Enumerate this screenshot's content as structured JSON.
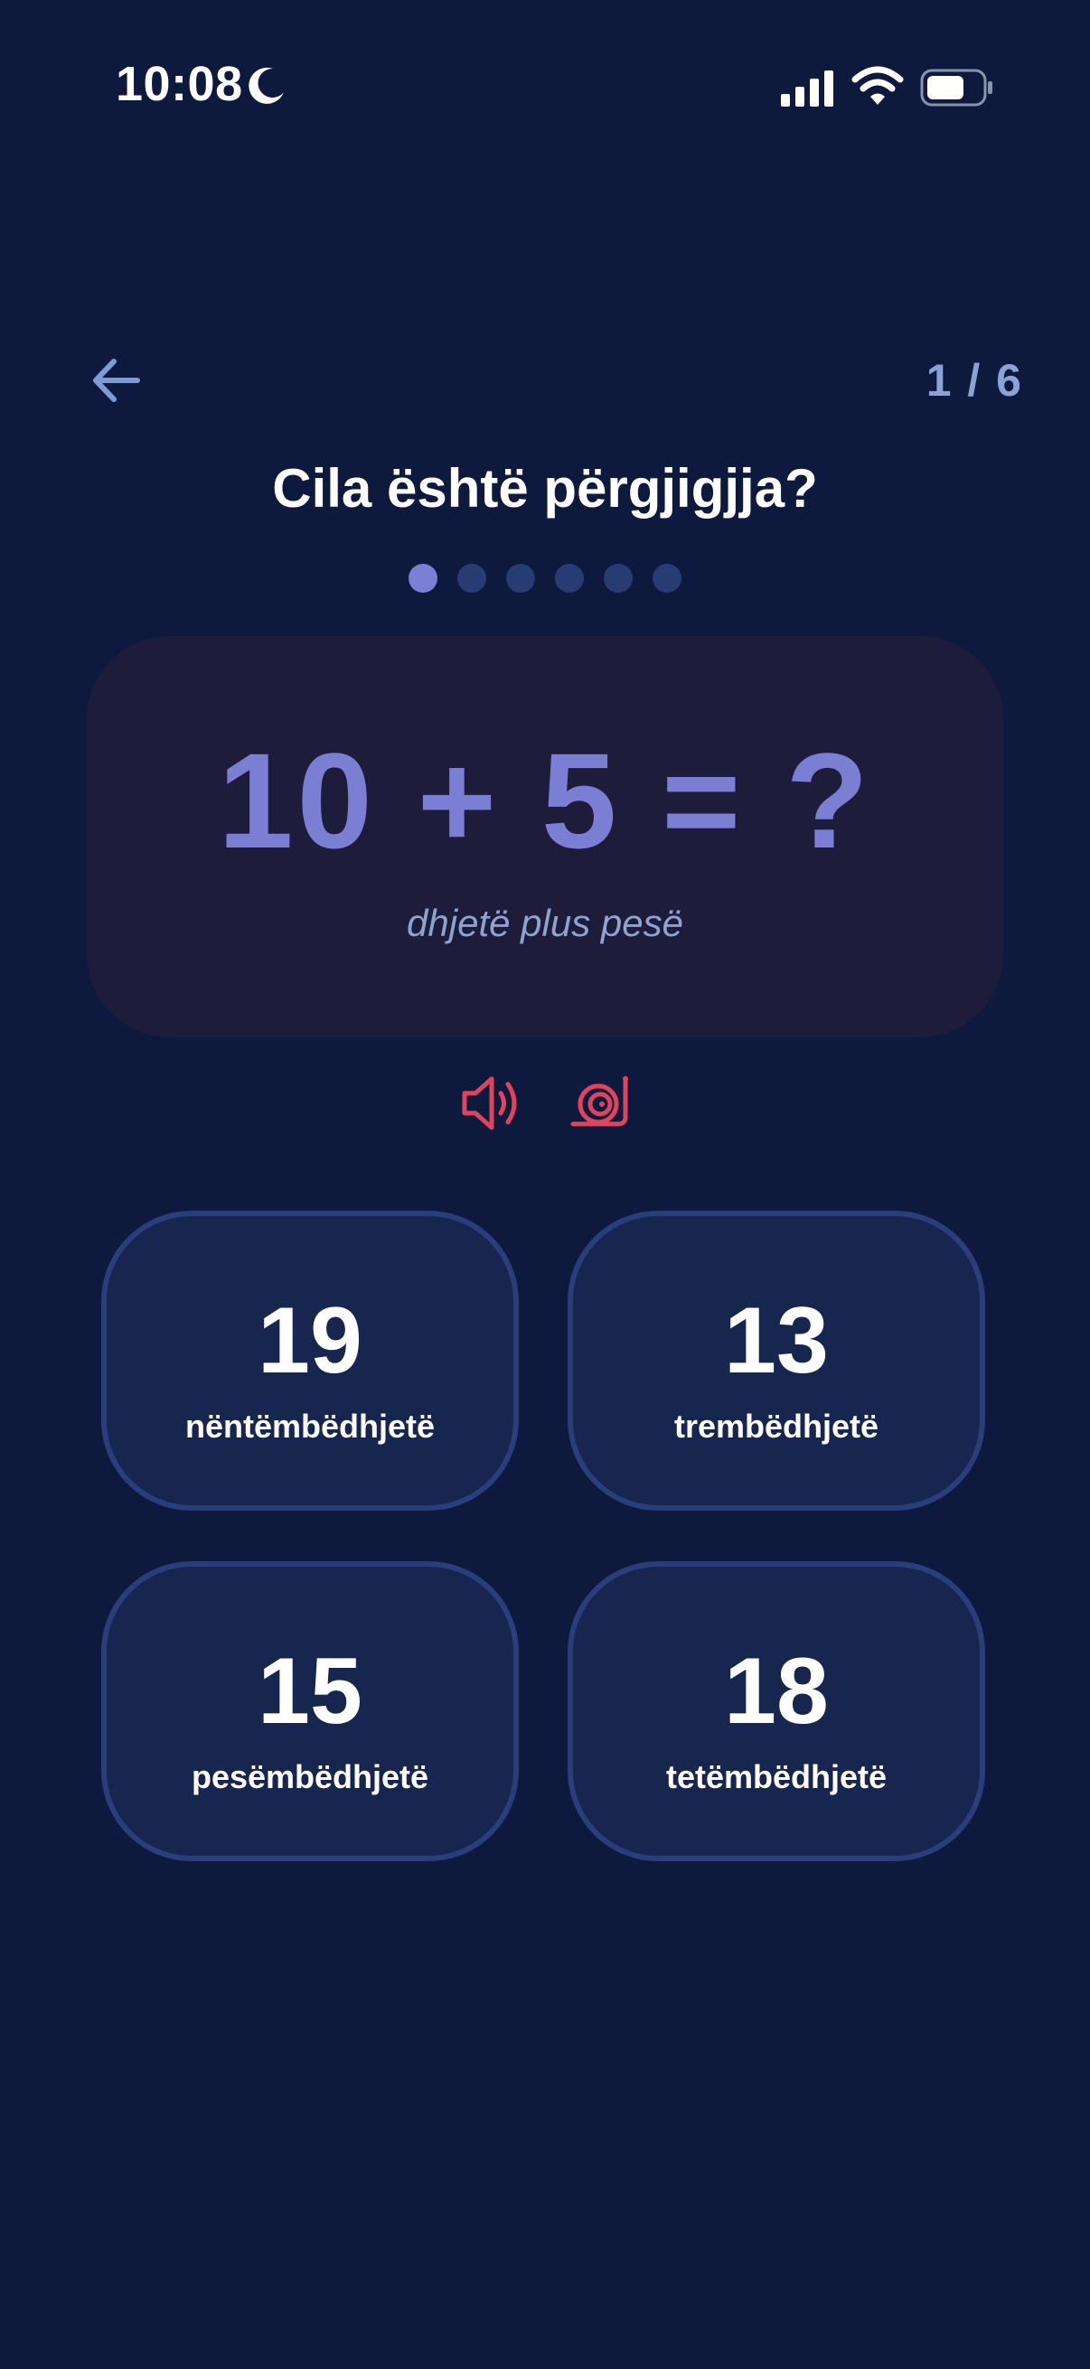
{
  "status_bar": {
    "time": "10:08",
    "icons": [
      "moon-icon",
      "signal-icon",
      "wifi-icon",
      "battery-icon"
    ]
  },
  "nav": {
    "back_icon": "back-arrow-icon",
    "progress": "1 / 6"
  },
  "question": {
    "title": "Cila është përgjigjja?",
    "total_steps": 6,
    "current_step": 1
  },
  "equation": {
    "text": "10 + 5 = ?",
    "words": "dhjetë plus pesë"
  },
  "audio": {
    "speaker_icon": "speaker-icon",
    "slow_icon": "snail-icon"
  },
  "answers": [
    {
      "number": "19",
      "word": "nëntëmbëdhjetë"
    },
    {
      "number": "13",
      "word": "trembëdhjetë"
    },
    {
      "number": "15",
      "word": "pesëmbëdhjetë"
    },
    {
      "number": "18",
      "word": "tetëmbëdhjetë"
    }
  ],
  "colors": {
    "background": "#0d1a3d",
    "card": "#1d1c3a",
    "accent": "#7a7fd4",
    "answer_bg": "#17264f",
    "answer_border": "#2a3e7c",
    "audio": "#e0445c",
    "muted_text": "#8aa2d6"
  }
}
